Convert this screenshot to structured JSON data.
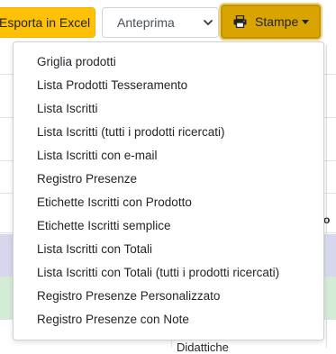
{
  "toolbar": {
    "export_label": "Esporta in Excel",
    "preview_select": {
      "selected": "Anteprima"
    },
    "prints_button_label": "Stampe"
  },
  "prints_menu": {
    "items": [
      {
        "label": "Griglia prodotti"
      },
      {
        "label": "Lista Prodotti Tesseramento"
      },
      {
        "label": "Lista Iscritti"
      },
      {
        "label": "Lista Iscritti (tutti i prodotti ricercati)"
      },
      {
        "label": "Lista Iscritti con e-mail"
      },
      {
        "label": "Registro Presenze"
      },
      {
        "label": "Etichette Iscritti con Prodotto"
      },
      {
        "label": "Etichette Iscritti semplice"
      },
      {
        "label": "Lista Iscritti con Totali"
      },
      {
        "label": "Lista Iscritti con Totali (tutti i prodotti ricercati)"
      },
      {
        "label": "Registro Presenze Personalizzato"
      },
      {
        "label": "Registro Presenze con Note"
      }
    ]
  },
  "background_table": {
    "partial_cell_text": "Didattiche",
    "sort_indicator": "o"
  },
  "colors": {
    "warning": "#ffc107",
    "warning_active": "#d9a300",
    "row_purple": "#d6d6ec",
    "row_green": "#d3ecd6"
  },
  "icons": {
    "prints_button": "printer-icon",
    "select": "chevron-down-icon"
  }
}
